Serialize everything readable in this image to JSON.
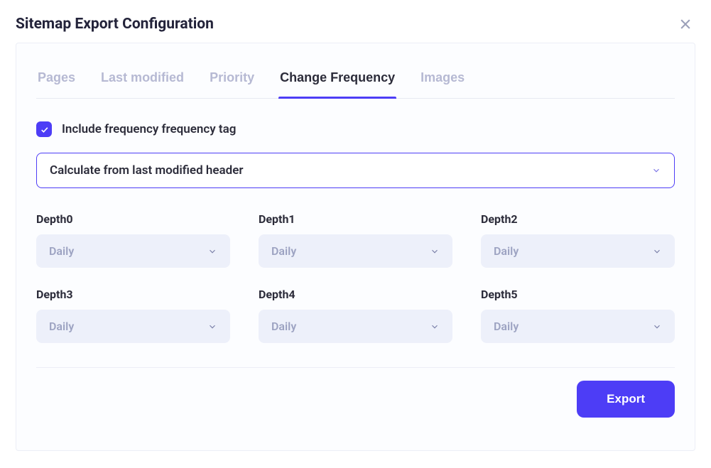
{
  "header": {
    "title": "Sitemap Export Configuration"
  },
  "tabs": [
    {
      "label": "Pages"
    },
    {
      "label": "Last modified"
    },
    {
      "label": "Priority"
    },
    {
      "label": "Change Frequency"
    },
    {
      "label": "Images"
    }
  ],
  "active_tab_index": 3,
  "include_checkbox": {
    "checked": true,
    "label": "Include frequency frequency tag"
  },
  "mode_select": {
    "value": "Calculate from last modified header"
  },
  "depth_fields": [
    {
      "label": "Depth0",
      "value": "Daily"
    },
    {
      "label": "Depth1",
      "value": "Daily"
    },
    {
      "label": "Depth2",
      "value": "Daily"
    },
    {
      "label": "Depth3",
      "value": "Daily"
    },
    {
      "label": "Depth4",
      "value": "Daily"
    },
    {
      "label": "Depth5",
      "value": "Daily"
    }
  ],
  "footer": {
    "export_label": "Export"
  }
}
